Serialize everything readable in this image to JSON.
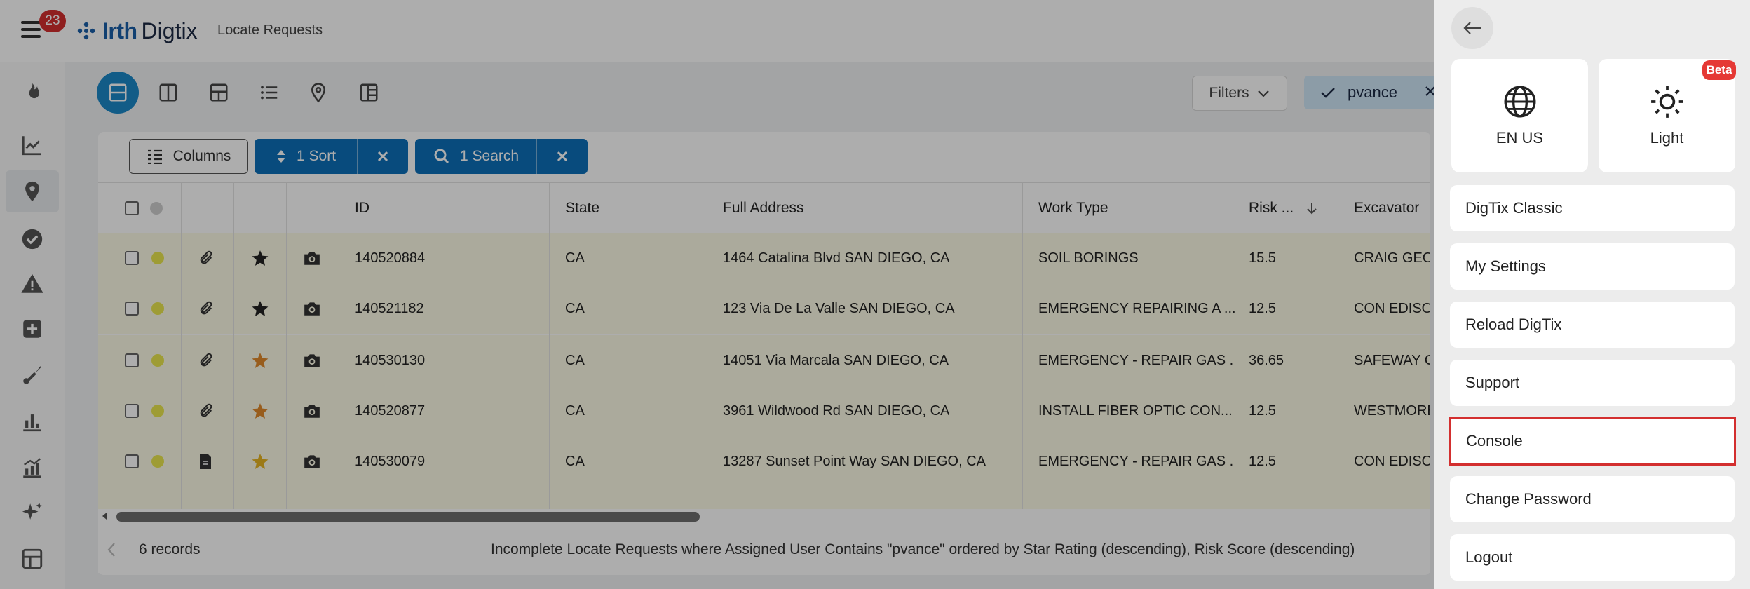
{
  "header": {
    "notification_count": "23",
    "logo_part_a": "Irth",
    "logo_part_b": "Digtix",
    "page_title": "Locate Requests"
  },
  "rail_icons": [
    "flame-icon",
    "trending-chart-icon",
    "map-pin-icon",
    "check-circle-icon",
    "warning-icon",
    "plus-box-icon",
    "shovel-icon",
    "bar-chart-icon",
    "analytics-icon",
    "sparkles-icon",
    "layout-icon"
  ],
  "toolbar": {
    "filters_label": "Filters",
    "user_chip_label": "pvance"
  },
  "grid_toolbar": {
    "columns_label": "Columns",
    "sort_label": "1 Sort",
    "search_label": "1 Search"
  },
  "table": {
    "columns": {
      "id": "ID",
      "state": "State",
      "address": "Full Address",
      "work_type": "Work Type",
      "risk": "Risk ...",
      "excavator": "Excavator"
    },
    "rows": [
      {
        "id": "140520884",
        "state": "CA",
        "address": "1464 Catalina Blvd SAN DIEGO, CA",
        "work_type": "SOIL BORINGS",
        "risk": "15.5",
        "excavator": "CRAIG GEOT",
        "star": "dark",
        "doc": "paperclip-icon"
      },
      {
        "id": "140521182",
        "state": "CA",
        "address": "123 Via De La Valle SAN DIEGO, CA",
        "work_type": "EMERGENCY REPAIRING A ...",
        "risk": "12.5",
        "excavator": "CON EDISON",
        "star": "dark",
        "doc": "paperclip-icon"
      },
      {
        "id": "140530130",
        "state": "CA",
        "address": "14051 Via Marcala SAN DIEGO, CA",
        "work_type": "EMERGENCY - REPAIR GAS ...",
        "risk": "36.65",
        "excavator": "SAFEWAY CO",
        "star": "orange",
        "doc": "paperclip-icon"
      },
      {
        "id": "140520877",
        "state": "CA",
        "address": "3961 Wildwood Rd SAN DIEGO, CA",
        "work_type": "INSTALL FIBER OPTIC CON...",
        "risk": "12.5",
        "excavator": "WESTMOREL",
        "star": "orange",
        "doc": "paperclip-icon"
      },
      {
        "id": "140530079",
        "state": "CA",
        "address": "13287 Sunset Point Way SAN DIEGO, CA",
        "work_type": "EMERGENCY - REPAIR GAS ...",
        "risk": "12.5",
        "excavator": "CON EDISON",
        "star": "gold",
        "doc": "document-icon"
      }
    ]
  },
  "footer": {
    "records": "6 records",
    "query_description": "Incomplete Locate Requests where Assigned User Contains \"pvance\" ordered by Star Rating (descending), Risk Score (descending)"
  },
  "drawer": {
    "language_label": "EN US",
    "theme_label": "Light",
    "beta_badge": "Beta",
    "menu": [
      {
        "label": "DigTix Classic",
        "name": "menu-digtix-classic"
      },
      {
        "label": "My Settings",
        "name": "menu-my-settings"
      },
      {
        "label": "Reload DigTix",
        "name": "menu-reload-digtix"
      },
      {
        "label": "Support",
        "name": "menu-support"
      },
      {
        "label": "Console",
        "name": "menu-console"
      },
      {
        "label": "Change Password",
        "name": "menu-change-password"
      },
      {
        "label": "Logout",
        "name": "menu-logout"
      }
    ]
  },
  "colors": {
    "brand_blue": "#1a5fa8",
    "action_blue": "#0d6fb8",
    "active_view": "#1b88c8",
    "row_highlight": "#fcfbe6",
    "badge_red": "#d32f2f",
    "star_dark": "#222222",
    "star_orange": "#e08a2c",
    "star_gold": "#e6b422"
  }
}
